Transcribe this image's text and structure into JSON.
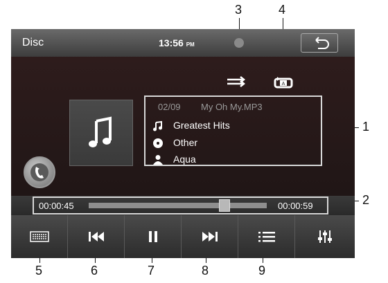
{
  "topbar": {
    "source": "Disc",
    "time": "13:56",
    "ampm": "PM"
  },
  "track": {
    "index": "02/09",
    "filename": "My Oh My.MP3",
    "title": "Greatest Hits",
    "genre": "Other",
    "artist": "Aqua"
  },
  "progress": {
    "elapsed": "00:00:45",
    "total": "00:00:59",
    "fraction": 0.763
  },
  "callouts": [
    "1",
    "2",
    "3",
    "4",
    "5",
    "6",
    "7",
    "8",
    "9"
  ],
  "icons": {
    "back": "back-arrow-icon",
    "shuffle": "shuffle-icon",
    "repeat": "repeat-all-icon",
    "album": "music-note-icon",
    "phone": "phone-icon",
    "keyboard": "keyboard-icon",
    "prev": "previous-track-icon",
    "pause": "pause-icon",
    "next": "next-track-icon",
    "list": "playlist-icon",
    "eq": "equalizer-icon"
  },
  "colors": {
    "highlight": "#d8d8d8",
    "text_dim": "#9a9a9a"
  }
}
